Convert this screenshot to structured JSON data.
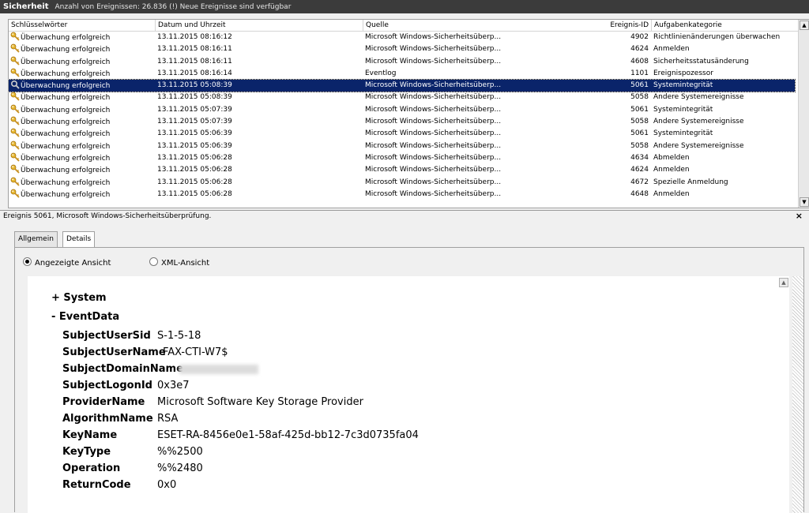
{
  "title": {
    "log_name": "Sicherheit",
    "info": "Anzahl von Ereignissen: 26.836 (!) Neue Ereignisse sind verfügbar"
  },
  "columns": {
    "keywords": "Schlüsselwörter",
    "date": "Datum und Uhrzeit",
    "source": "Quelle",
    "event_id": "Ereignis-ID",
    "category": "Aufgabenkategorie"
  },
  "rows": [
    {
      "keyword": "Überwachung erfolgreich",
      "date": "13.11.2015 08:16:12",
      "source": "Microsoft Windows-Sicherheitsüberp...",
      "id": "4902",
      "category": "Richtlinienänderungen überwachen"
    },
    {
      "keyword": "Überwachung erfolgreich",
      "date": "13.11.2015 08:16:11",
      "source": "Microsoft Windows-Sicherheitsüberp...",
      "id": "4624",
      "category": "Anmelden"
    },
    {
      "keyword": "Überwachung erfolgreich",
      "date": "13.11.2015 08:16:11",
      "source": "Microsoft Windows-Sicherheitsüberp...",
      "id": "4608",
      "category": "Sicherheitsstatusänderung"
    },
    {
      "keyword": "Überwachung erfolgreich",
      "date": "13.11.2015 08:16:14",
      "source": "Eventlog",
      "id": "1101",
      "category": "Ereignispozessor"
    },
    {
      "keyword": "Überwachung erfolgreich",
      "date": "13.11.2015 05:08:39",
      "source": "Microsoft Windows-Sicherheitsüberp...",
      "id": "5061",
      "category": "Systemintegrität"
    },
    {
      "keyword": "Überwachung erfolgreich",
      "date": "13.11.2015 05:08:39",
      "source": "Microsoft Windows-Sicherheitsüberp...",
      "id": "5058",
      "category": "Andere Systemereignisse"
    },
    {
      "keyword": "Überwachung erfolgreich",
      "date": "13.11.2015 05:07:39",
      "source": "Microsoft Windows-Sicherheitsüberp...",
      "id": "5061",
      "category": "Systemintegrität"
    },
    {
      "keyword": "Überwachung erfolgreich",
      "date": "13.11.2015 05:07:39",
      "source": "Microsoft Windows-Sicherheitsüberp...",
      "id": "5058",
      "category": "Andere Systemereignisse"
    },
    {
      "keyword": "Überwachung erfolgreich",
      "date": "13.11.2015 05:06:39",
      "source": "Microsoft Windows-Sicherheitsüberp...",
      "id": "5061",
      "category": "Systemintegrität"
    },
    {
      "keyword": "Überwachung erfolgreich",
      "date": "13.11.2015 05:06:39",
      "source": "Microsoft Windows-Sicherheitsüberp...",
      "id": "5058",
      "category": "Andere Systemereignisse"
    },
    {
      "keyword": "Überwachung erfolgreich",
      "date": "13.11.2015 05:06:28",
      "source": "Microsoft Windows-Sicherheitsüberp...",
      "id": "4634",
      "category": "Abmelden"
    },
    {
      "keyword": "Überwachung erfolgreich",
      "date": "13.11.2015 05:06:28",
      "source": "Microsoft Windows-Sicherheitsüberp...",
      "id": "4624",
      "category": "Anmelden"
    },
    {
      "keyword": "Überwachung erfolgreich",
      "date": "13.11.2015 05:06:28",
      "source": "Microsoft Windows-Sicherheitsüberp...",
      "id": "4672",
      "category": "Spezielle Anmeldung"
    },
    {
      "keyword": "Überwachung erfolgreich",
      "date": "13.11.2015 05:06:28",
      "source": "Microsoft Windows-Sicherheitsüberp...",
      "id": "4648",
      "category": "Anmelden"
    }
  ],
  "selected_row_index": 4,
  "detail": {
    "title": "Ereignis 5061, Microsoft Windows-Sicherheitsüberprüfung.",
    "close": "×",
    "tabs": [
      "Allgemein",
      "Details"
    ],
    "active_tab": "Details",
    "view_options": [
      "Angezeigte Ansicht",
      "XML-Ansicht"
    ],
    "selected_view": "Angezeigte Ansicht",
    "system_label": "+ System",
    "eventdata_label": "- EventData",
    "fields": [
      {
        "name": "SubjectUserSid",
        "value": "S-1-5-18"
      },
      {
        "name": "SubjectUserName",
        "value": "FAX-CTI-W7$"
      },
      {
        "name": "SubjectDomainName",
        "value": ""
      },
      {
        "name": "SubjectLogonId",
        "value": "0x3e7"
      },
      {
        "name": "ProviderName",
        "value": "Microsoft Software Key Storage Provider"
      },
      {
        "name": "AlgorithmName",
        "value": "RSA"
      },
      {
        "name": "KeyName",
        "value": "ESET-RA-8456e0e1-58af-425d-bb12-7c3d0735fa04"
      },
      {
        "name": "KeyType",
        "value": "%%2500"
      },
      {
        "name": "Operation",
        "value": "%%2480"
      },
      {
        "name": "ReturnCode",
        "value": "0x0"
      }
    ]
  },
  "colors": {
    "selection": "#0a246a",
    "titlebar": "#3b3b3b"
  },
  "icons": {
    "row_key": "key-icon",
    "row_selected": "magnifier-icon"
  }
}
